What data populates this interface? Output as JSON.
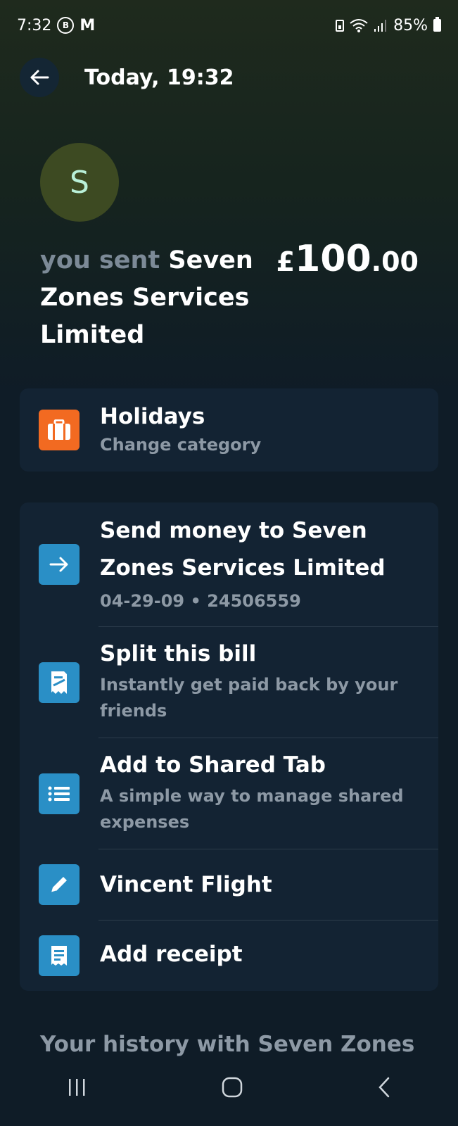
{
  "status_bar": {
    "time": "7:32",
    "badge_b": "B",
    "badge_m": "M",
    "battery_percent": "85%"
  },
  "header": {
    "title": "Today, 19:32"
  },
  "avatar": {
    "initial": "S",
    "color": "#3d4a22"
  },
  "transaction": {
    "prefix": "you sent",
    "recipient": "Seven Zones Services Limited",
    "amount_currency": "£",
    "amount_whole": "100",
    "amount_fraction": ".00"
  },
  "category": {
    "icon": "suitcase-icon",
    "title": "Holidays",
    "subtitle": "Change category",
    "color": "#f26a21"
  },
  "actions": [
    {
      "icon": "arrow-right-icon",
      "title_line1": "Send money to Seven",
      "title_line2": "Zones Services Limited",
      "subtitle": "04-29-09 • 24506559"
    },
    {
      "icon": "receipt-split-icon",
      "title": "Split this bill",
      "subtitle_line1": "Instantly get paid back by your",
      "subtitle_line2": "friends"
    },
    {
      "icon": "list-icon",
      "title": "Add to Shared Tab",
      "subtitle_line1": "A simple way to manage shared",
      "subtitle_line2": "expenses"
    },
    {
      "icon": "pencil-icon",
      "title": "Vincent Flight"
    },
    {
      "icon": "receipt-icon",
      "title": "Add receipt"
    }
  ],
  "history": {
    "heading": "Your history with Seven Zones"
  },
  "colors": {
    "accent_blue": "#2a8fc6",
    "category_orange": "#f26a21",
    "card_bg": "#132333"
  }
}
